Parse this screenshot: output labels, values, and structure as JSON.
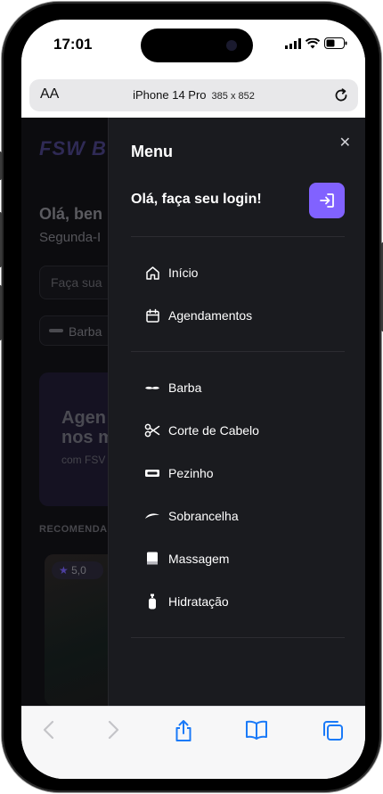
{
  "status_bar": {
    "time": "17:01"
  },
  "browser": {
    "text_size_label": "AA",
    "device_name": "iPhone 14 Pro",
    "device_size": "385 x 852"
  },
  "background_page": {
    "logo": "FSW B",
    "greeting": "Olá, ben",
    "date": "Segunda-I",
    "search_placeholder": "Faça sua",
    "category_chip": "Barba",
    "banner_title_line1": "Agen",
    "banner_title_line2": "nos m",
    "banner_subtitle": "com FSV",
    "section_title": "RECOMENDA",
    "rating": "5,0"
  },
  "menu": {
    "title": "Menu",
    "login_text": "Olá, faça seu login!",
    "nav_items": [
      {
        "label": "Início",
        "icon": "home-icon"
      },
      {
        "label": "Agendamentos",
        "icon": "calendar-icon"
      }
    ],
    "services": [
      {
        "label": "Barba",
        "icon": "mustache-icon"
      },
      {
        "label": "Corte de Cabelo",
        "icon": "scissors-icon"
      },
      {
        "label": "Pezinho",
        "icon": "razor-icon"
      },
      {
        "label": "Sobrancelha",
        "icon": "eyebrow-icon"
      },
      {
        "label": "Massagem",
        "icon": "towel-icon"
      },
      {
        "label": "Hidratação",
        "icon": "bottle-icon"
      }
    ]
  },
  "colors": {
    "accent": "#8162ff",
    "menu_bg": "#1a1b1f",
    "page_bg": "#0c0c0f",
    "toolbar_icon": "#1a7af8"
  }
}
